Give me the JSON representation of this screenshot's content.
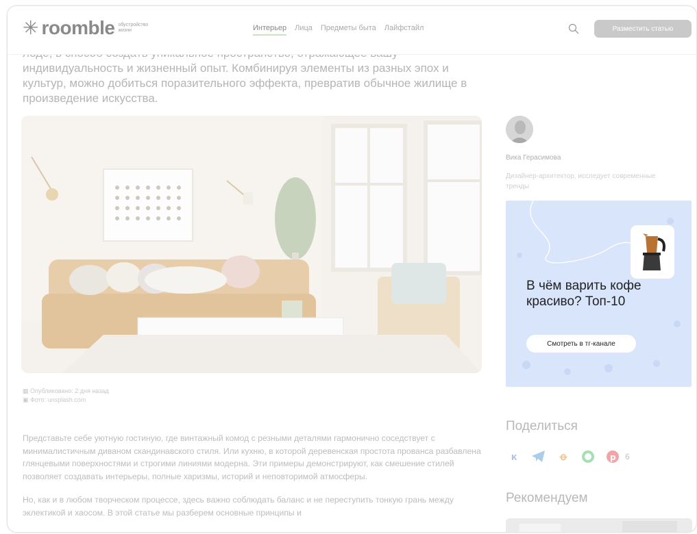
{
  "header": {
    "logo_text": "roomble",
    "logo_subtitle": "обустройство жизни",
    "nav": [
      "Интерьер",
      "Лица",
      "Предметы быта",
      "Лайфстайл"
    ],
    "cta_label": "Разместить статью"
  },
  "article": {
    "intro": "лоде, в способ создать уникальное пространство, отражающее вашу индивидуальность и жизненный опыт. Комбинируя элементы из разных эпох и культур, можно добиться поразительного эффекта, превратив обычное жилище в произведение искусства.",
    "meta_published": "Опубликовано: 2 дня назад",
    "meta_photo": "Фото: unsplash.com",
    "paragraph1": "Представьте себе уютную гостиную, где винтажный комод с резными деталями гармонично соседствует с минималистичным диваном скандинавского стиля. Или кухню, в которой деревенская простота прованса разбавлена глянцевыми поверхностями и строгими линиями модерна. Эти примеры демонстрируют, как смешение стилей позволяет создавать интерьеры, полные харизмы, историй и неповторимой атмосферы.",
    "paragraph2": "Но, как и в любом творческом процессе, здесь важно соблюдать баланс и не переступить тонкую грань между эклектикой и хаосом. В этой статье мы разберем основные принципы и"
  },
  "author": {
    "name": "Вика Герасимова",
    "description": "Дизайнер-архитектор, исследует современные тренды"
  },
  "promo": {
    "title": "В чём варить кофе красиво? Топ-10",
    "button_label": "Смотреть в тг-канале"
  },
  "share": {
    "title": "Поделиться",
    "count": "6",
    "icons": [
      "vk-icon",
      "telegram-icon",
      "odnoklassniki-icon",
      "whatsapp-icon",
      "pinterest-icon"
    ]
  },
  "recommend": {
    "title": "Рекомендуем"
  }
}
